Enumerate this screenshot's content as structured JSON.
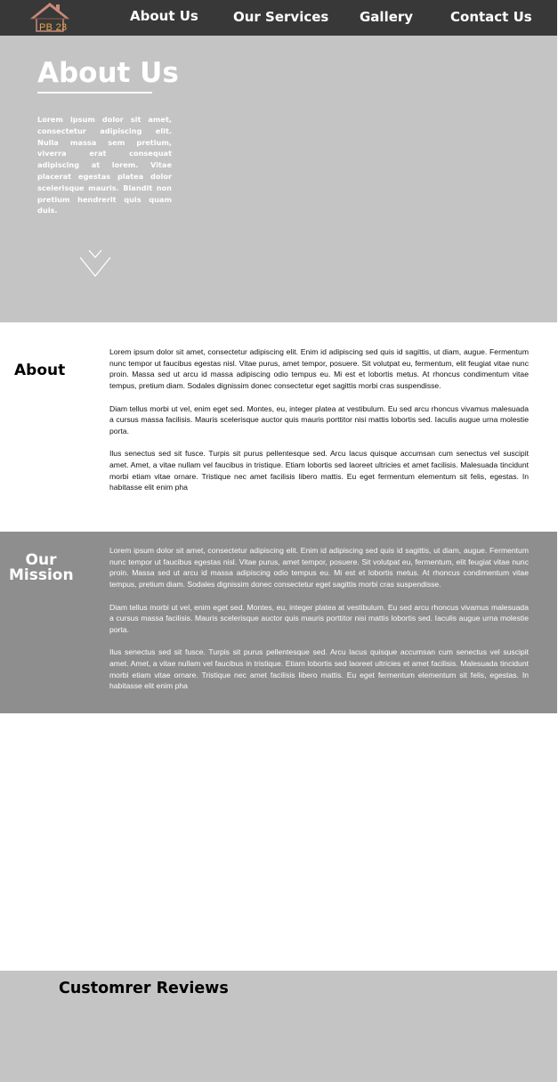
{
  "nav": {
    "logo_text": "PB 23",
    "links": [
      "About Us",
      "Our Services",
      "Gallery",
      "Contact Us"
    ]
  },
  "hero": {
    "title": "About Us",
    "text": "Lorem ipsum dolor sit amet, consectetur adipiscing elit. Nulla massa sem pretium, viverra erat consequat adipiscing at lorem. Vitae placerat egestas platea dolor scelerisque mauris. Blandit non pretium hendrerit quis quam duis."
  },
  "about": {
    "label": "About",
    "paragraphs": [
      "Lorem ipsum dolor sit amet, consectetur adipiscing elit. Enim id adipiscing sed quis id sagittis, ut diam, augue. Fermentum nunc tempor ut faucibus egestas nisl. Vitae purus, amet tempor, posuere. Sit volutpat eu, fermentum, elit feugiat vitae nunc proin. Massa sed ut arcu id massa adipiscing odio tempus eu. Mi est et lobortis metus. At rhoncus condimentum vitae tempus, pretium diam. Sodales dignissim donec consectetur eget sagittis morbi cras suspendisse.",
      "Diam tellus morbi ut vel, enim eget sed. Montes, eu, integer platea at vestibulum. Eu sed arcu rhoncus vivamus malesuada a cursus massa facilisis. Mauris scelerisque auctor quis mauris porttitor nisi mattis lobortis sed. Iaculis augue urna molestie porta.",
      "Ilus senectus sed sit fusce. Turpis sit purus pellentesque sed. Arcu lacus quisque accumsan cum senectus vel suscipit amet. Amet, a vitae nullam vel faucibus in tristique. Etiam lobortis sed laoreet ultricies et amet facilisis. Malesuada tincidunt morbi etiam vitae ornare. Tristique nec amet facilisis libero mattis. Eu eget fermentum elementum sit felis, egestas. In habitasse elit enim pha"
    ]
  },
  "mission": {
    "label_line1": "Our",
    "label_line2": "Mission",
    "paragraphs": [
      "Lorem ipsum dolor sit amet, consectetur adipiscing elit. Enim id adipiscing sed quis id sagittis, ut diam, augue. Fermentum nunc tempor ut faucibus egestas nisl. Vitae purus, amet tempor, posuere. Sit volutpat eu, fermentum, elit feugiat vitae nunc proin. Massa sed ut arcu id massa adipiscing odio tempus eu. Mi est et lobortis metus. At rhoncus condimentum vitae tempus, pretium diam. Sodales dignissim donec consectetur eget sagittis morbi cras suspendisse.",
      "Diam tellus morbi ut vel, enim eget sed. Montes, eu, integer platea at vestibulum. Eu sed arcu rhoncus vivamus malesuada a cursus massa facilisis. Mauris scelerisque auctor quis mauris porttitor nisi mattis lobortis sed. Iaculis augue urna molestie porta.",
      "Ilus senectus sed sit fusce. Turpis sit purus pellentesque sed. Arcu lacus quisque accumsan cum senectus vel suscipit amet. Amet, a vitae nullam vel faucibus in tristique. Etiam lobortis sed laoreet ultricies et amet facilisis. Malesuada tincidunt morbi etiam vitae ornare. Tristique nec amet facilisis libero mattis. Eu eget fermentum elementum sit felis, egestas. In habitasse elit enim pha"
    ]
  },
  "reviews": {
    "title": "Customrer Reviews"
  },
  "colors": {
    "nav_bg": "#383838",
    "hero_bg": "#c4c4c4",
    "mission_bg": "#8e8e8e",
    "logo_roof": "#c98a7a",
    "logo_text": "#e8a94c"
  }
}
